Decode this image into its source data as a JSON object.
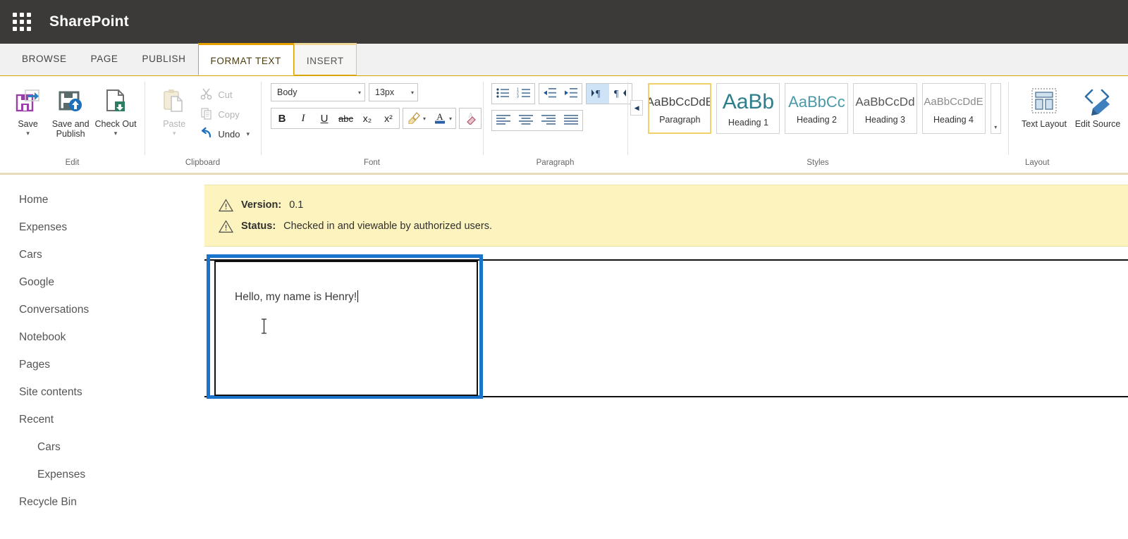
{
  "suite": {
    "app_name": "SharePoint",
    "waffle_icon": "app-launcher-grid-icon"
  },
  "ribbon_tabs": [
    {
      "label": "BROWSE",
      "state": "normal"
    },
    {
      "label": "PAGE",
      "state": "normal"
    },
    {
      "label": "PUBLISH",
      "state": "normal"
    },
    {
      "label": "FORMAT TEXT",
      "state": "selected"
    },
    {
      "label": "INSERT",
      "state": "adjacent"
    }
  ],
  "ribbon": {
    "groups": [
      {
        "name": "Edit",
        "label": "Edit",
        "buttons": [
          {
            "label": "Save",
            "icon": "save-floppy-icon",
            "caret": "▾",
            "enabled": true
          },
          {
            "label": "Save and Publish",
            "icon": "save-publish-icon",
            "caret": "",
            "enabled": true
          },
          {
            "label": "Check Out",
            "icon": "check-out-icon",
            "caret": "▾",
            "enabled": true
          }
        ]
      },
      {
        "name": "Clipboard",
        "label": "Clipboard",
        "paste": {
          "label": "Paste",
          "icon": "clipboard-paste-icon",
          "caret": "▾",
          "enabled": false
        },
        "commands": [
          {
            "label": "Cut",
            "icon": "scissors-icon",
            "enabled": false,
            "caret": ""
          },
          {
            "label": "Copy",
            "icon": "copy-pages-icon",
            "enabled": false,
            "caret": ""
          },
          {
            "label": "Undo",
            "icon": "undo-arrow-icon",
            "enabled": true,
            "caret": "▾"
          }
        ]
      },
      {
        "name": "Font",
        "label": "Font",
        "font_family": {
          "value": "Body",
          "caret": "▾"
        },
        "font_size": {
          "value": "13px",
          "caret": "▾"
        },
        "format_buttons": [
          {
            "label": "B",
            "name": "bold-button"
          },
          {
            "label": "I",
            "name": "italic-button"
          },
          {
            "label": "U",
            "name": "underline-button"
          },
          {
            "label": "abc",
            "name": "strikethrough-button"
          },
          {
            "label": "x₂",
            "name": "subscript-button"
          },
          {
            "label": "x²",
            "name": "superscript-button"
          }
        ],
        "highlight": {
          "icon": "text-highlight-icon",
          "caret": "▾"
        },
        "font_color": {
          "icon": "font-color-a-icon",
          "caret": "▾",
          "swatch": "#2a5fa5"
        },
        "clear_format": {
          "icon": "clear-formatting-eraser-icon"
        }
      },
      {
        "name": "Paragraph",
        "label": "Paragraph",
        "list_buttons": [
          {
            "name": "bulleted-list-button",
            "icon": "bullet-list-icon"
          },
          {
            "name": "numbered-list-button",
            "icon": "numbered-list-icon"
          }
        ],
        "indent_buttons": [
          {
            "name": "decrease-indent-button",
            "icon": "decrease-indent-icon"
          },
          {
            "name": "increase-indent-button",
            "icon": "increase-indent-icon"
          }
        ],
        "direction_buttons": [
          {
            "name": "ltr-direction-button",
            "icon": "ltr-paragraph-icon",
            "active": true
          },
          {
            "name": "rtl-direction-button",
            "icon": "rtl-paragraph-icon",
            "active": false
          }
        ],
        "align_buttons": [
          {
            "name": "align-left-button",
            "icon": "align-left-icon"
          },
          {
            "name": "align-center-button",
            "icon": "align-center-icon"
          },
          {
            "name": "align-right-button",
            "icon": "align-right-icon"
          },
          {
            "name": "align-justify-button",
            "icon": "align-justify-icon"
          }
        ]
      },
      {
        "name": "Styles",
        "label": "Styles",
        "prev_arrow": "◀",
        "scroll_caret": "▾",
        "tiles": [
          {
            "preview": "AaBbCcDdE",
            "name": "Paragraph",
            "selected": true,
            "size": 17,
            "color": "#444444"
          },
          {
            "preview": "AaBb",
            "name": "Heading 1",
            "selected": false,
            "size": 30,
            "color": "#2e7d8a"
          },
          {
            "preview": "AaBbCc",
            "name": "Heading 2",
            "selected": false,
            "size": 22,
            "color": "#4c9aa8"
          },
          {
            "preview": "AaBbCcDd",
            "name": "Heading 3",
            "selected": false,
            "size": 17,
            "color": "#555555"
          },
          {
            "preview": "AaBbCcDdE",
            "name": "Heading 4",
            "selected": false,
            "size": 15,
            "color": "#7a7a7a"
          }
        ]
      },
      {
        "name": "Layout",
        "label": "Layout",
        "buttons": [
          {
            "label": "Text Layout",
            "icon": "text-layout-icon",
            "caret": "▾"
          },
          {
            "label": "Edit Source",
            "icon": "edit-source-code-icon",
            "caret": ""
          }
        ]
      }
    ]
  },
  "sidebar": {
    "items": [
      {
        "label": "Home",
        "sub": false
      },
      {
        "label": "Expenses",
        "sub": false
      },
      {
        "label": "Cars",
        "sub": false
      },
      {
        "label": "Google",
        "sub": false
      },
      {
        "label": "Conversations",
        "sub": false
      },
      {
        "label": "Notebook",
        "sub": false
      },
      {
        "label": "Pages",
        "sub": false
      },
      {
        "label": "Site contents",
        "sub": false
      },
      {
        "label": "Recent",
        "sub": false
      },
      {
        "label": "Cars",
        "sub": true
      },
      {
        "label": "Expenses",
        "sub": true
      },
      {
        "label": "Recycle Bin",
        "sub": false
      }
    ]
  },
  "notice": {
    "warning_icon": "warning-triangle-icon",
    "version_label": "Version:",
    "version_value": "0.1",
    "status_label": "Status:",
    "status_value": "Checked in and viewable by authorized users.",
    "background": "#fdf3bf"
  },
  "editor": {
    "text": "Hello, my name is Henry!",
    "focus_color": "#1a74cc",
    "cursor_icon": "i-beam-cursor"
  }
}
